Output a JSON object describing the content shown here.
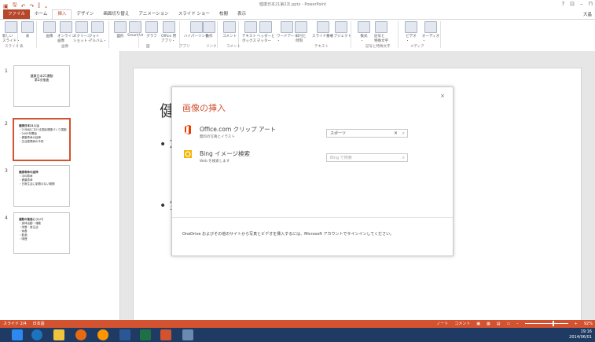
{
  "window": {
    "title": "健康日本21第2次.pptx - PowerPoint",
    "controls": [
      "?",
      "⊡",
      "–",
      "⊓"
    ],
    "qat": [
      "▣",
      "🖫",
      "↶",
      "↷",
      "⫿",
      "⌄"
    ]
  },
  "tabs": [
    "ファイル",
    "ホーム",
    "挿入",
    "デザイン",
    "画面切り替え",
    "アニメーション",
    "スライド ショー",
    "校閲",
    "表示"
  ],
  "active_tab": "挿入",
  "user": "大畠 ",
  "ribbon": {
    "buttons": [
      {
        "label": "新しい\nスライド・"
      },
      {
        "label": "表"
      },
      {
        "label": "画像"
      },
      {
        "label": "オンライン\n画像"
      },
      {
        "label": "スクリーン\nショット・"
      },
      {
        "label": "フォト\nアルバム・"
      },
      {
        "label": "図形"
      },
      {
        "label": "SmartArt"
      },
      {
        "label": "グラフ"
      },
      {
        "label": "Office 用\nアプリ・"
      },
      {
        "label": "ハイパーリンク"
      },
      {
        "label": "動作"
      },
      {
        "label": "コメント"
      },
      {
        "label": "テキスト\nボックス・"
      },
      {
        "label": "ヘッダーと\nフッター"
      },
      {
        "label": "ワードアート\n・"
      },
      {
        "label": "日付と\n時刻"
      },
      {
        "label": "スライド番号"
      },
      {
        "label": "オブジェクト"
      },
      {
        "label": "数式\n・"
      },
      {
        "label": "記号と\n特殊文字"
      },
      {
        "label": "ビデオ\n・"
      },
      {
        "label": "オーディオ\n・"
      }
    ],
    "groups": [
      "スライド",
      "表",
      "画像",
      "図",
      "アプリ",
      "リンク",
      "コメント",
      "テキスト",
      "記号と特殊文字",
      "メディア"
    ]
  },
  "slides": [
    {
      "num": "1",
      "title": "健康日本21運動\n第2次推進",
      "lines": []
    },
    {
      "num": "2",
      "title": "",
      "lines": [
        "健康日本21とは",
        "・21世紀における国民健康づくり運動",
        "・2000年開始",
        "・健康寿命の延伸",
        "・生活習慣病の予防"
      ]
    },
    {
      "num": "3",
      "title": "",
      "lines": [
        "健康寿命の延伸",
        "・平均寿命",
        "・健康寿命",
        "・日常生活に制限のない期間"
      ]
    },
    {
      "num": "4",
      "title": "",
      "lines": [
        "運動の推進について",
        "・身体活動・運動",
        "・栄養・食生活",
        "・休養",
        "・飲酒",
        "・喫煙"
      ]
    }
  ],
  "main_slide": {
    "title": "健",
    "bullets": [
      "• 2",
      "• 第"
    ]
  },
  "dialog": {
    "title": "画像の挿入",
    "close": "×",
    "sources": [
      {
        "name": "Office.com クリップ アート",
        "subtitle": "無料の写真とイラスト",
        "search_value": "スポーツ",
        "search_placeholder": ""
      },
      {
        "name": "Bing イメージ検索",
        "subtitle": "Web を検索します",
        "search_value": "",
        "search_placeholder": "Bing で検索"
      }
    ],
    "footer": "OneDrive およびその他のサイトから写真とビデオを挿入するには、Microsoft アカウントでサインインしてください。"
  },
  "status": {
    "slide_info": "スライド 2/4",
    "language": "日本語",
    "notes": "ノート",
    "comments": "コメント",
    "zoom": "92%",
    "zoom_level": 0.92
  },
  "tray": {
    "time": "19:16",
    "date": "2014/06/01"
  },
  "colors": {
    "accent": "#d35230",
    "file_tab": "#b7472a",
    "taskbar": "#1f3b63"
  }
}
